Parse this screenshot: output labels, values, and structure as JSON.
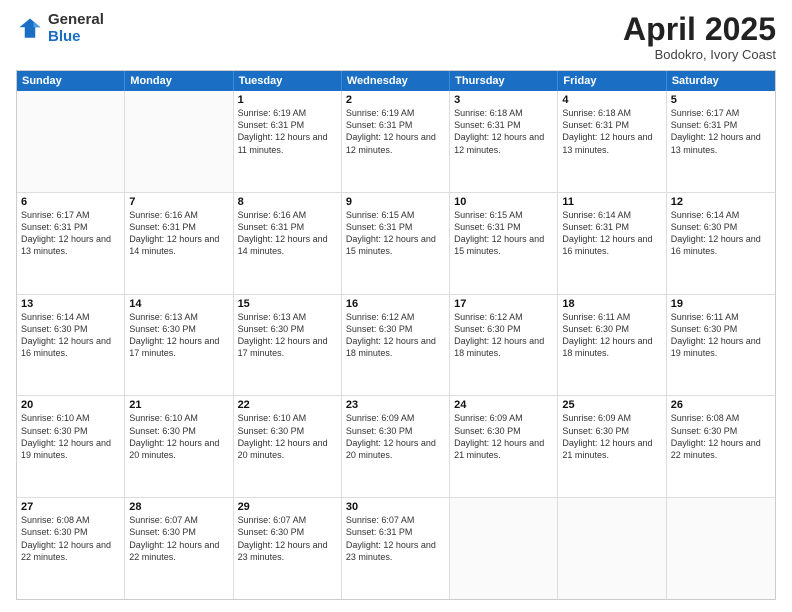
{
  "logo": {
    "general": "General",
    "blue": "Blue"
  },
  "title": "April 2025",
  "subtitle": "Bodokro, Ivory Coast",
  "header_days": [
    "Sunday",
    "Monday",
    "Tuesday",
    "Wednesday",
    "Thursday",
    "Friday",
    "Saturday"
  ],
  "weeks": [
    [
      {
        "day": "",
        "info": ""
      },
      {
        "day": "",
        "info": ""
      },
      {
        "day": "1",
        "info": "Sunrise: 6:19 AM\nSunset: 6:31 PM\nDaylight: 12 hours and 11 minutes."
      },
      {
        "day": "2",
        "info": "Sunrise: 6:19 AM\nSunset: 6:31 PM\nDaylight: 12 hours and 12 minutes."
      },
      {
        "day": "3",
        "info": "Sunrise: 6:18 AM\nSunset: 6:31 PM\nDaylight: 12 hours and 12 minutes."
      },
      {
        "day": "4",
        "info": "Sunrise: 6:18 AM\nSunset: 6:31 PM\nDaylight: 12 hours and 13 minutes."
      },
      {
        "day": "5",
        "info": "Sunrise: 6:17 AM\nSunset: 6:31 PM\nDaylight: 12 hours and 13 minutes."
      }
    ],
    [
      {
        "day": "6",
        "info": "Sunrise: 6:17 AM\nSunset: 6:31 PM\nDaylight: 12 hours and 13 minutes."
      },
      {
        "day": "7",
        "info": "Sunrise: 6:16 AM\nSunset: 6:31 PM\nDaylight: 12 hours and 14 minutes."
      },
      {
        "day": "8",
        "info": "Sunrise: 6:16 AM\nSunset: 6:31 PM\nDaylight: 12 hours and 14 minutes."
      },
      {
        "day": "9",
        "info": "Sunrise: 6:15 AM\nSunset: 6:31 PM\nDaylight: 12 hours and 15 minutes."
      },
      {
        "day": "10",
        "info": "Sunrise: 6:15 AM\nSunset: 6:31 PM\nDaylight: 12 hours and 15 minutes."
      },
      {
        "day": "11",
        "info": "Sunrise: 6:14 AM\nSunset: 6:31 PM\nDaylight: 12 hours and 16 minutes."
      },
      {
        "day": "12",
        "info": "Sunrise: 6:14 AM\nSunset: 6:30 PM\nDaylight: 12 hours and 16 minutes."
      }
    ],
    [
      {
        "day": "13",
        "info": "Sunrise: 6:14 AM\nSunset: 6:30 PM\nDaylight: 12 hours and 16 minutes."
      },
      {
        "day": "14",
        "info": "Sunrise: 6:13 AM\nSunset: 6:30 PM\nDaylight: 12 hours and 17 minutes."
      },
      {
        "day": "15",
        "info": "Sunrise: 6:13 AM\nSunset: 6:30 PM\nDaylight: 12 hours and 17 minutes."
      },
      {
        "day": "16",
        "info": "Sunrise: 6:12 AM\nSunset: 6:30 PM\nDaylight: 12 hours and 18 minutes."
      },
      {
        "day": "17",
        "info": "Sunrise: 6:12 AM\nSunset: 6:30 PM\nDaylight: 12 hours and 18 minutes."
      },
      {
        "day": "18",
        "info": "Sunrise: 6:11 AM\nSunset: 6:30 PM\nDaylight: 12 hours and 18 minutes."
      },
      {
        "day": "19",
        "info": "Sunrise: 6:11 AM\nSunset: 6:30 PM\nDaylight: 12 hours and 19 minutes."
      }
    ],
    [
      {
        "day": "20",
        "info": "Sunrise: 6:10 AM\nSunset: 6:30 PM\nDaylight: 12 hours and 19 minutes."
      },
      {
        "day": "21",
        "info": "Sunrise: 6:10 AM\nSunset: 6:30 PM\nDaylight: 12 hours and 20 minutes."
      },
      {
        "day": "22",
        "info": "Sunrise: 6:10 AM\nSunset: 6:30 PM\nDaylight: 12 hours and 20 minutes."
      },
      {
        "day": "23",
        "info": "Sunrise: 6:09 AM\nSunset: 6:30 PM\nDaylight: 12 hours and 20 minutes."
      },
      {
        "day": "24",
        "info": "Sunrise: 6:09 AM\nSunset: 6:30 PM\nDaylight: 12 hours and 21 minutes."
      },
      {
        "day": "25",
        "info": "Sunrise: 6:09 AM\nSunset: 6:30 PM\nDaylight: 12 hours and 21 minutes."
      },
      {
        "day": "26",
        "info": "Sunrise: 6:08 AM\nSunset: 6:30 PM\nDaylight: 12 hours and 22 minutes."
      }
    ],
    [
      {
        "day": "27",
        "info": "Sunrise: 6:08 AM\nSunset: 6:30 PM\nDaylight: 12 hours and 22 minutes."
      },
      {
        "day": "28",
        "info": "Sunrise: 6:07 AM\nSunset: 6:30 PM\nDaylight: 12 hours and 22 minutes."
      },
      {
        "day": "29",
        "info": "Sunrise: 6:07 AM\nSunset: 6:30 PM\nDaylight: 12 hours and 23 minutes."
      },
      {
        "day": "30",
        "info": "Sunrise: 6:07 AM\nSunset: 6:31 PM\nDaylight: 12 hours and 23 minutes."
      },
      {
        "day": "",
        "info": ""
      },
      {
        "day": "",
        "info": ""
      },
      {
        "day": "",
        "info": ""
      }
    ]
  ]
}
